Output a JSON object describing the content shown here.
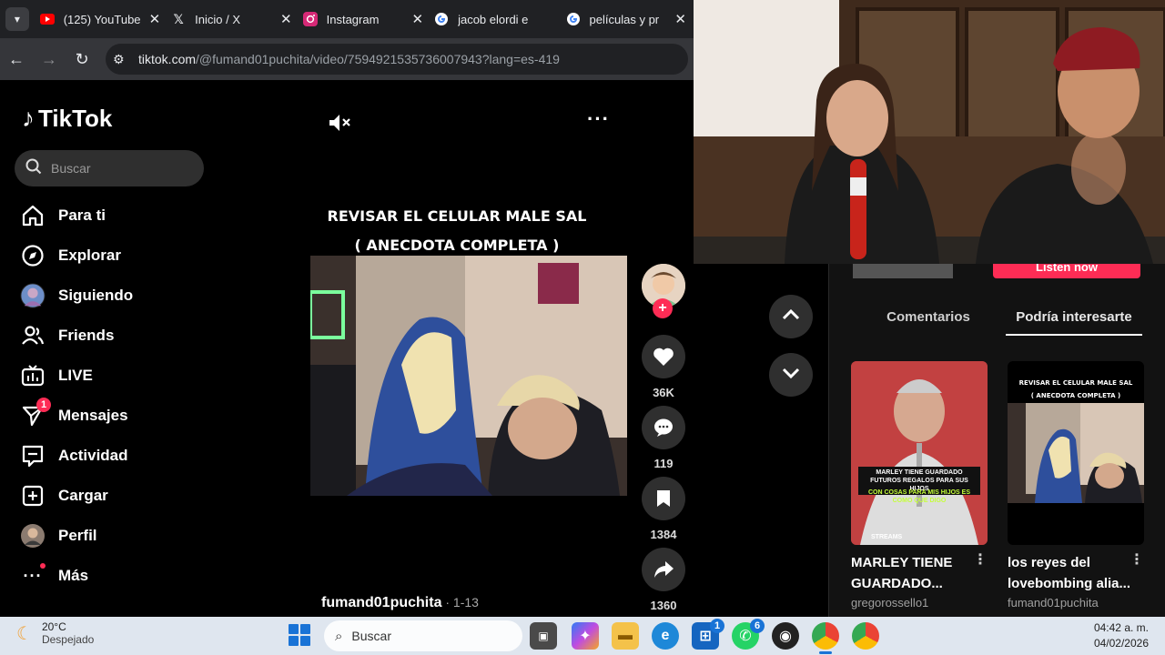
{
  "browser": {
    "tabs": [
      {
        "label": "(125) YouTube",
        "icon": "youtube-icon"
      },
      {
        "label": "Inicio / X",
        "icon": "x-icon"
      },
      {
        "label": "Instagram",
        "icon": "instagram-icon"
      },
      {
        "label": "jacob elordi e",
        "icon": "google-icon"
      },
      {
        "label": "películas y pr",
        "icon": "google-icon"
      }
    ],
    "url_host": "tiktok.com",
    "url_path": "/@fumand01puchita/video/7594921535736007943?lang=es-419"
  },
  "tiktok": {
    "brand": "TikTok",
    "search_placeholder": "Buscar",
    "nav": [
      {
        "label": "Para ti",
        "icon": "home-icon"
      },
      {
        "label": "Explorar",
        "icon": "compass-icon"
      },
      {
        "label": "Siguiendo",
        "icon": "following-avatar-icon"
      },
      {
        "label": "Friends",
        "icon": "friends-icon"
      },
      {
        "label": "LIVE",
        "icon": "live-tv-icon"
      },
      {
        "label": "Mensajes",
        "icon": "messages-icon",
        "badge": "1"
      },
      {
        "label": "Actividad",
        "icon": "activity-icon"
      },
      {
        "label": "Cargar",
        "icon": "upload-icon"
      },
      {
        "label": "Perfil",
        "icon": "profile-avatar-icon"
      },
      {
        "label": "Más",
        "icon": "more-dots-icon"
      }
    ]
  },
  "video": {
    "title_line1": "REVISAR EL CELULAR MALE SAL",
    "title_line2": "( ANECDOTA COMPLETA )",
    "author": "fumand01puchita",
    "date": " · 1-13",
    "likes": "36K",
    "comments": "119",
    "saves": "1384",
    "shares": "1360"
  },
  "side_panel": {
    "listen_label": "Listen now",
    "tab_comments": "Comentarios",
    "tab_suggested": "Podría interesarte",
    "cards": [
      {
        "title": "MARLEY TIENE GUARDADO...",
        "author": "gregorossello1",
        "overlay_top": "MARLEY TIENE GUARDADO FUTUROS REGALOS PARA SUS HIJOS",
        "overlay_bottom": "CON COSAS PARA MIS HIJOS ES COMO QUE DIGO",
        "overlay_tag": "STREAMS"
      },
      {
        "title": "los reyes del lovebombing alia...",
        "author": "fumand01puchita",
        "overlay_top": "REVISAR EL CELULAR MALE SAL",
        "overlay_bottom": "( ANECDOTA COMPLETA )"
      }
    ]
  },
  "taskbar": {
    "temp": "20°C",
    "weather": "Despejado",
    "search_placeholder": "Buscar",
    "time": "04:42 a. m.",
    "date": "04/02/2026",
    "store_badge": "1",
    "whatsapp_badge": "6"
  }
}
